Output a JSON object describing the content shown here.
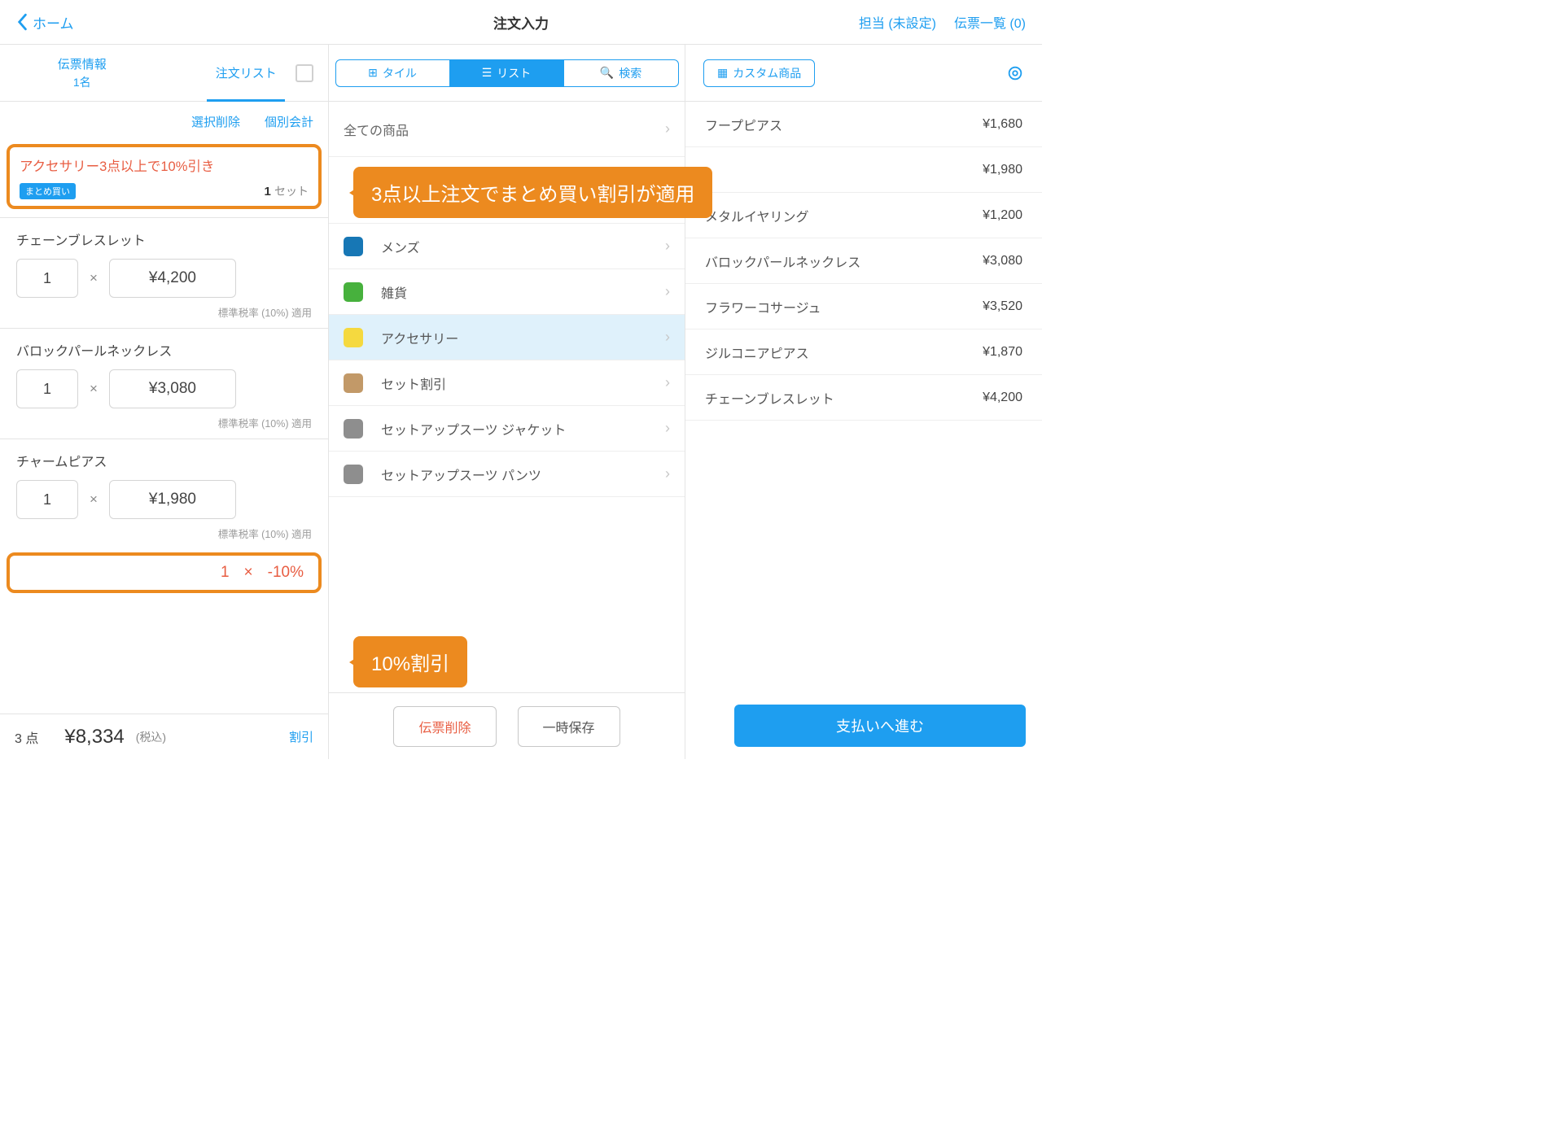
{
  "header": {
    "back": "ホーム",
    "title": "注文入力",
    "staff": "担当 (未設定)",
    "slips": "伝票一覧 (0)"
  },
  "leftTabs": {
    "slip": "伝票情報",
    "slipSub": "1名",
    "order": "注文リスト"
  },
  "actions": {
    "delete": "選択削除",
    "split": "個別会計"
  },
  "bundle": {
    "title": "アクセサリー3点以上で10%引き",
    "tag": "まとめ買い",
    "setQty": "1",
    "setUnit": "セット"
  },
  "items": [
    {
      "name": "チェーンブレスレット",
      "qty": "1",
      "price": "¥4,200",
      "tax": "標準税率 (10%) 適用"
    },
    {
      "name": "バロックパールネックレス",
      "qty": "1",
      "price": "¥3,080",
      "tax": "標準税率 (10%) 適用"
    },
    {
      "name": "チャームピアス",
      "qty": "1",
      "price": "¥1,980",
      "tax": "標準税率 (10%) 適用"
    }
  ],
  "discount": {
    "qty": "1",
    "mult": "×",
    "value": "-10%"
  },
  "footer": {
    "qty": "3 点",
    "total": "¥8,334",
    "taxIn": "(税込)",
    "discount": "割引"
  },
  "seg": {
    "tile": "タイル",
    "list": "リスト",
    "search": "検索"
  },
  "cats": {
    "all": "全ての商品",
    "list": [
      {
        "name": "メンズ",
        "c": "#1777b5"
      },
      {
        "name": "雑貨",
        "c": "#47b13d"
      },
      {
        "name": "アクセサリー",
        "c": "#f5d93f",
        "sel": true
      },
      {
        "name": "セット割引",
        "c": "#c29968"
      },
      {
        "name": "セットアップスーツ ジャケット",
        "c": "#8e8e8e"
      },
      {
        "name": "セットアップスーツ パンツ",
        "c": "#8e8e8e"
      }
    ]
  },
  "annot": {
    "top": "3点以上注文でまとめ買い割引が適用",
    "bottom": "10%割引"
  },
  "btns": {
    "del": "伝票削除",
    "save": "一時保存"
  },
  "custom": "カスタム商品",
  "products": [
    {
      "name": "フープピアス",
      "price": "¥1,680"
    },
    {
      "name": "",
      "price": "¥1,980"
    },
    {
      "name": "メタルイヤリング",
      "price": "¥1,200"
    },
    {
      "name": "バロックパールネックレス",
      "price": "¥3,080"
    },
    {
      "name": "フラワーコサージュ",
      "price": "¥3,520"
    },
    {
      "name": "ジルコニアピアス",
      "price": "¥1,870"
    },
    {
      "name": "チェーンブレスレット",
      "price": "¥4,200"
    }
  ],
  "pay": "支払いへ進む"
}
